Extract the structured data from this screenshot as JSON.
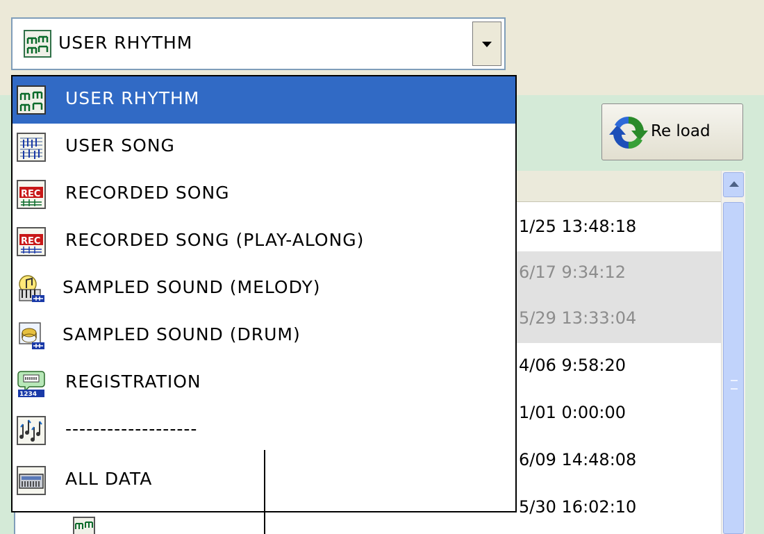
{
  "combo": {
    "value": "USER RHYTHM",
    "icon": "user-rhythm-icon"
  },
  "reload": {
    "label": "Re load",
    "icon": "reload-icon"
  },
  "dropdown": {
    "items": [
      {
        "label": "USER RHYTHM",
        "icon": "user-rhythm-icon",
        "selected": true
      },
      {
        "label": "USER SONG",
        "icon": "user-song-icon"
      },
      {
        "label": "RECORDED SONG",
        "icon": "recorded-song-icon"
      },
      {
        "label": "RECORDED SONG (PLAY-ALONG)",
        "icon": "recorded-song-icon"
      },
      {
        "label": "SAMPLED SOUND (MELODY)",
        "icon": "sampled-sound-melody-icon"
      },
      {
        "label": "SAMPLED SOUND (DRUM)",
        "icon": "sampled-sound-drum-icon"
      },
      {
        "label": "REGISTRATION",
        "icon": "registration-icon"
      },
      {
        "label": "-------------------",
        "icon": "music-notes-icon"
      },
      {
        "label": "ALL DATA",
        "icon": "keyboard-icon"
      }
    ]
  },
  "list": {
    "timestamps": [
      "1/25 13:48:18",
      "6/17 9:34:12",
      "5/29 13:33:04",
      "4/06 9:58:20",
      "1/01 0:00:00",
      "6/09 14:48:08",
      "5/30 16:02:10"
    ]
  },
  "colors": {
    "selection": "#316ac5",
    "panel": "#d4ead7",
    "chrome": "#ece9d8"
  }
}
